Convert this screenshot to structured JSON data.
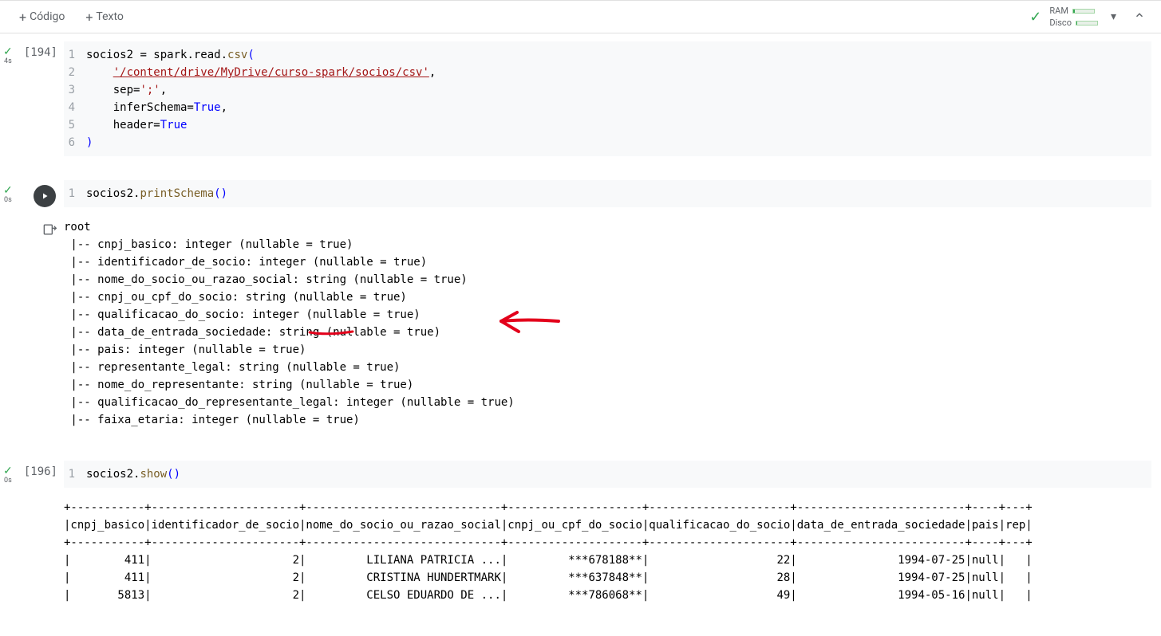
{
  "toolbar": {
    "code_label": "Código",
    "text_label": "Texto",
    "ram_label": "RAM",
    "disk_label": "Disco"
  },
  "cells": [
    {
      "exec_count": "[194]",
      "exec_time": "4s",
      "code_lines": [
        {
          "n": "1",
          "html": "<span class='tok-plain'>socios2 </span><span class='tok-op'>=</span><span class='tok-plain'> spark.read.</span><span class='tok-fn'>csv</span><span class='tok-paren'>(</span>"
        },
        {
          "n": "2",
          "html": "    <span class='tok-str-link'>'/content/drive/MyDrive/curso-spark/socios/csv'</span><span class='tok-plain'>,</span>"
        },
        {
          "n": "3",
          "html": "    <span class='tok-plain'>sep=</span><span class='tok-str'>';'</span><span class='tok-plain'>,</span>"
        },
        {
          "n": "4",
          "html": "    <span class='tok-plain'>inferSchema=</span><span class='tok-bool'>True</span><span class='tok-plain'>,</span>"
        },
        {
          "n": "5",
          "html": "    <span class='tok-plain'>header=</span><span class='tok-bool'>True</span>"
        },
        {
          "n": "6",
          "html": "<span class='tok-paren'>)</span>"
        }
      ]
    },
    {
      "exec_count": "",
      "exec_time": "0s",
      "run_active": true,
      "code_lines": [
        {
          "n": "1",
          "html": "<span class='tok-plain'>socios2.</span><span class='tok-fn'>printSchema</span><span class='tok-paren'>()</span>"
        }
      ],
      "output_schema": [
        "root",
        " |-- cnpj_basico: integer (nullable = true)",
        " |-- identificador_de_socio: integer (nullable = true)",
        " |-- nome_do_socio_ou_razao_social: string (nullable = true)",
        " |-- cnpj_ou_cpf_do_socio: string (nullable = true)",
        " |-- qualificacao_do_socio: integer (nullable = true)",
        " |-- data_de_entrada_sociedade: string (nullable = true)",
        " |-- pais: integer (nullable = true)",
        " |-- representante_legal: string (nullable = true)",
        " |-- nome_do_representante: string (nullable = true)",
        " |-- qualificacao_do_representante_legal: integer (nullable = true)",
        " |-- faixa_etaria: integer (nullable = true)"
      ]
    },
    {
      "exec_count": "[196]",
      "exec_time": "0s",
      "code_lines": [
        {
          "n": "1",
          "html": "<span class='tok-plain'>socios2.</span><span class='tok-fn'>show</span><span class='tok-paren'>()</span>"
        }
      ],
      "table_output": {
        "columns": [
          "cnpj_basico",
          "identificador_de_socio",
          "nome_do_socio_ou_razao_social",
          "cnpj_ou_cpf_do_socio",
          "qualificacao_do_socio",
          "data_de_entrada_sociedade",
          "pais",
          "rep"
        ],
        "rows": [
          [
            "411",
            "2",
            "LILIANA PATRICIA ...",
            "***678188**",
            "22",
            "1994-07-25",
            "null",
            ""
          ],
          [
            "411",
            "2",
            "CRISTINA HUNDERTMARK",
            "***637848**",
            "28",
            "1994-07-25",
            "null",
            ""
          ],
          [
            "5813",
            "2",
            "CELSO EDUARDO DE ...",
            "***786068**",
            "49",
            "1994-05-16",
            "null",
            ""
          ]
        ]
      }
    }
  ]
}
